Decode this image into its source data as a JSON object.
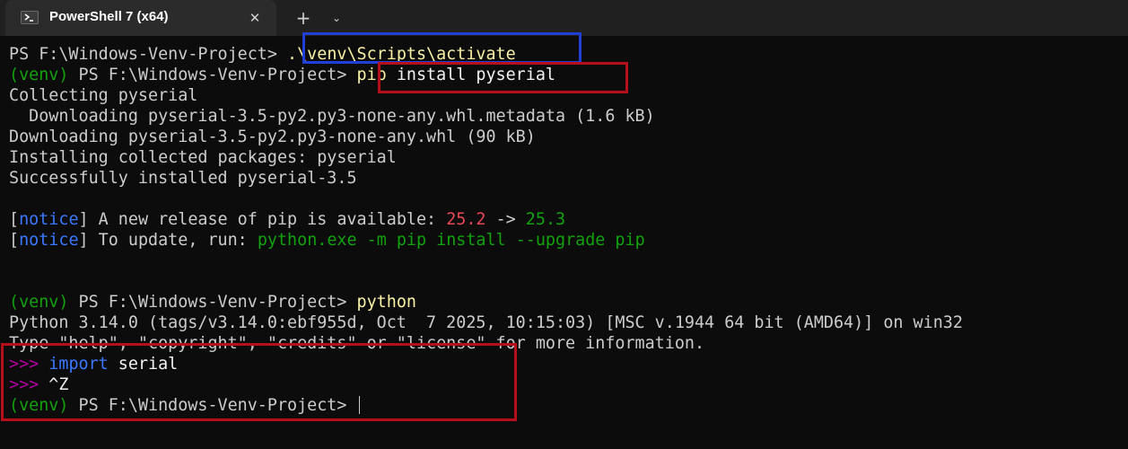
{
  "window": {
    "tab_title": "PowerShell 7 (x64)",
    "tab_icon": "powershell-icon",
    "close_glyph": "✕",
    "new_tab_glyph": "+",
    "dropdown_glyph": "⌄"
  },
  "colors": {
    "background": "#0c0c0c",
    "text": "#cccccc",
    "venv_green": "#13a10e",
    "command_yellow": "#f9f1a5",
    "old_version_red": "#e74856",
    "notice_blue": "#3b78ff",
    "repl_magenta": "#b4009e",
    "highlight_blue": "#1f3fd6",
    "highlight_red": "#b40f1a"
  },
  "terminal": {
    "line1": {
      "prompt": "PS F:\\Windows-Venv-Project> ",
      "command": ".\\venv\\Scripts\\activate"
    },
    "line2": {
      "venv": "(venv)",
      "prompt": " PS F:\\Windows-Venv-Project> ",
      "cmd": "pip",
      "args": " install pyserial"
    },
    "line3": "Collecting pyserial",
    "line4": "  Downloading pyserial-3.5-py2.py3-none-any.whl.metadata (1.6 kB)",
    "line5": "Downloading pyserial-3.5-py2.py3-none-any.whl (90 kB)",
    "line6": "Installing collected packages: pyserial",
    "line7": "Successfully installed pyserial-3.5",
    "notice1": {
      "open": "[",
      "tag": "notice",
      "close": "]",
      "text": " A new release of pip is available: ",
      "old_version": "25.2",
      "arrow": " -> ",
      "new_version": "25.3"
    },
    "notice2": {
      "open": "[",
      "tag": "notice",
      "close": "]",
      "text": " To update, run: ",
      "command": "python.exe -m pip install --upgrade pip"
    },
    "line_python": {
      "venv": "(venv)",
      "prompt": " PS F:\\Windows-Venv-Project> ",
      "command": "python"
    },
    "python_banner": "Python 3.14.0 (tags/v3.14.0:ebf955d, Oct  7 2025, 10:15:03) [MSC v.1944 64 bit (AMD64)] on win32",
    "python_help": "Type \"help\", \"copyright\", \"credits\" or \"license\" for more information.",
    "repl1": {
      "prompt": ">>> ",
      "keyword": "import",
      "rest": " serial"
    },
    "repl2": {
      "prompt": ">>> ",
      "rest": "^Z"
    },
    "final": {
      "venv": "(venv)",
      "prompt": " PS F:\\Windows-Venv-Project> "
    }
  }
}
